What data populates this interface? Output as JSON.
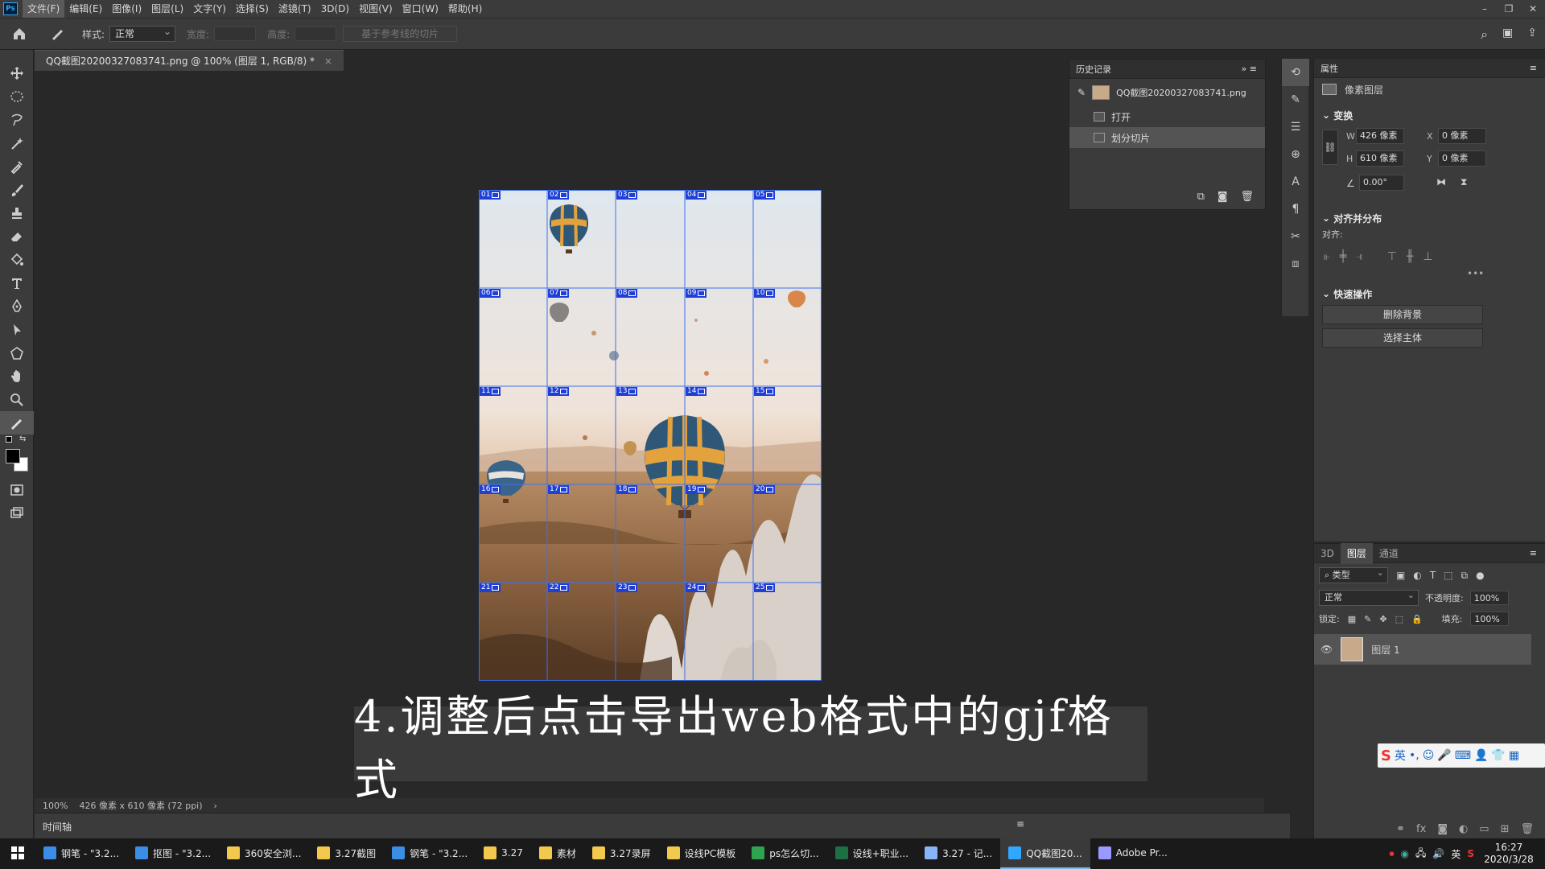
{
  "app": {
    "logo": "Ps"
  },
  "menu": [
    "文件(F)",
    "编辑(E)",
    "图像(I)",
    "图层(L)",
    "文字(Y)",
    "选择(S)",
    "滤镜(T)",
    "3D(D)",
    "视图(V)",
    "窗口(W)",
    "帮助(H)"
  ],
  "options": {
    "style_label": "样式:",
    "style_value": "正常",
    "width_label": "宽度:",
    "height_label": "高度:",
    "slices_from_guides": "基于参考线的切片"
  },
  "document": {
    "tab_title": "QQ截图20200327083741.png @ 100% (图层 1, RGB/8) *",
    "zoom": "100%",
    "size_info": "426 像素 x 610 像素 (72 ppi)"
  },
  "slices": [
    "01",
    "02",
    "03",
    "04",
    "05",
    "06",
    "07",
    "08",
    "09",
    "10",
    "11",
    "12",
    "13",
    "14",
    "15",
    "16",
    "17",
    "18",
    "19",
    "20",
    "21",
    "22",
    "23",
    "24",
    "25"
  ],
  "caption": "4.调整后点击导出web格式中的gjf格式",
  "timeline_label": "时间轴",
  "history": {
    "title": "历史记录",
    "snapshot": "QQ截图20200327083741.png",
    "items": [
      "打开",
      "划分切片"
    ]
  },
  "properties": {
    "title": "属性",
    "layer_type": "像素图层",
    "transform_title": "变换",
    "w_label": "W",
    "w_value": "426 像素",
    "h_label": "H",
    "h_value": "610 像素",
    "x_label": "X",
    "x_value": "0 像素",
    "y_label": "Y",
    "y_value": "0 像素",
    "angle_value": "0.00°",
    "align_title": "对齐并分布",
    "align_label": "对齐:",
    "quick_title": "快速操作",
    "remove_bg": "删除背景",
    "select_subject": "选择主体"
  },
  "layers": {
    "tabs": [
      "3D",
      "图层",
      "通道"
    ],
    "filter_kind": "类型",
    "blend_mode": "正常",
    "opacity_label": "不透明度:",
    "opacity_value": "100%",
    "lock_label": "锁定:",
    "fill_label": "填充:",
    "fill_value": "100%",
    "layer_name": "图层 1"
  },
  "taskbar": [
    {
      "label": "钢笔 - \"3.2...",
      "color": "#3a8ee6"
    },
    {
      "label": "抠图 - \"3.2...",
      "color": "#3a8ee6"
    },
    {
      "label": "360安全浏...",
      "color": "#f2c94c"
    },
    {
      "label": "3.27截图",
      "color": "#f2c94c"
    },
    {
      "label": "钢笔 - \"3.2...",
      "color": "#3a8ee6"
    },
    {
      "label": "3.27",
      "color": "#f2c94c"
    },
    {
      "label": "素材",
      "color": "#f2c94c"
    },
    {
      "label": "3.27录屏",
      "color": "#f2c94c"
    },
    {
      "label": "设线PC模板",
      "color": "#f2c94c"
    },
    {
      "label": "ps怎么切...",
      "color": "#2ea44f"
    },
    {
      "label": "设线+职业...",
      "color": "#1d7044"
    },
    {
      "label": "3.27 - 记...",
      "color": "#8ab4f8"
    },
    {
      "label": "QQ截图20...",
      "color": "#31a8ff"
    },
    {
      "label": "Adobe Pr...",
      "color": "#9999ff"
    }
  ],
  "tray": {
    "lang": "英",
    "time": "16:27",
    "date": "2020/3/28"
  },
  "ime": {
    "label": "英"
  },
  "colors": {
    "accent": "#31a8ff",
    "slice_blue": "#1f3fd6",
    "panel": "#3b3b3b",
    "canvas": "#282828"
  }
}
